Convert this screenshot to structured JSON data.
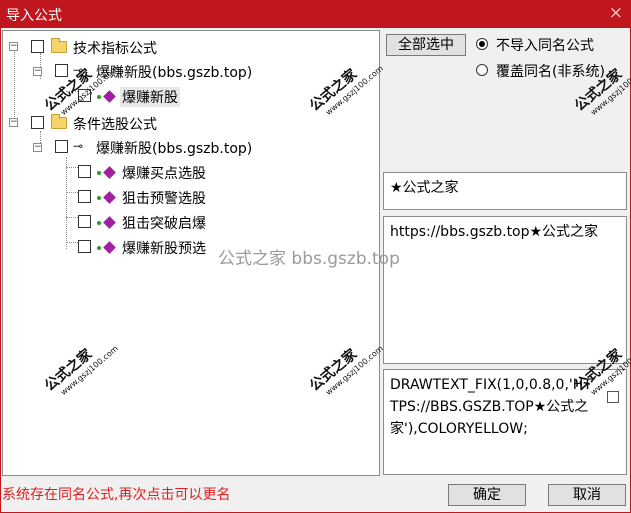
{
  "window": {
    "title": "导入公式",
    "close_icon": "×"
  },
  "tree": {
    "groups": [
      {
        "label": "技术指标公式"
      },
      {
        "label": "条件选股公式"
      }
    ],
    "items": [
      {
        "label": "爆赚新股(bbs.gszb.top)"
      },
      {
        "label": "爆赚新股"
      },
      {
        "label": "爆赚新股(bbs.gszb.top)"
      },
      {
        "label": "爆赚买点选股"
      },
      {
        "label": "狙击预警选股"
      },
      {
        "label": "狙击突破启爆"
      },
      {
        "label": "爆赚新股预选"
      }
    ]
  },
  "actions": {
    "select_all": "全部选中",
    "option_skip": "不导入同名公式",
    "option_overwrite": "覆盖同名(非系统)",
    "selected_option": "skip"
  },
  "info": {
    "name": "★公式之家",
    "description": "https://bbs.gszb.top★公式之家",
    "code": "DRAWTEXT_FIX(1,0,0.8,0,'HTTPS://BBS.GSZB.TOP★公式之家'),COLORYELLOW;"
  },
  "watermark": {
    "brand": "公式之家",
    "url": "www.gszj100.com",
    "center_text": "公式之家 bbs.gszb.top"
  },
  "status": "系统存在同名公式,再次点击可以更名",
  "buttons": {
    "ok": "确定",
    "cancel": "取消"
  },
  "colors": {
    "titlebar": "#c0171e",
    "status_text": "#e0201f",
    "formula_icon": "#a020a0"
  }
}
